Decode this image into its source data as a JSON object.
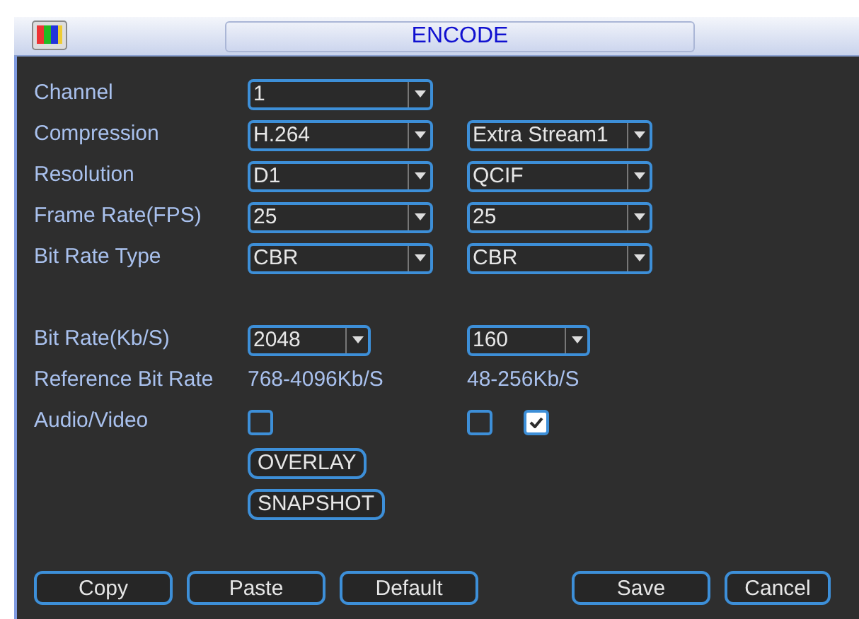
{
  "window": {
    "title": "ENCODE"
  },
  "rows": [
    {
      "kind": "dropdowns",
      "label": "Channel",
      "values": [
        "1"
      ]
    },
    {
      "kind": "dropdowns",
      "label": "Compression",
      "values": [
        "H.264",
        "Extra Stream1"
      ]
    },
    {
      "kind": "dropdowns",
      "label": "Resolution",
      "values": [
        "D1",
        "QCIF"
      ]
    },
    {
      "kind": "dropdowns",
      "label": "Frame Rate(FPS)",
      "values": [
        "25",
        "25"
      ]
    },
    {
      "kind": "dropdowns",
      "label": "Bit Rate Type",
      "values": [
        "CBR",
        "CBR"
      ]
    },
    {
      "kind": "spacer"
    },
    {
      "kind": "short_dropdowns",
      "label": "Bit Rate(Kb/S)",
      "values": [
        "2048",
        "160"
      ]
    },
    {
      "kind": "texts",
      "label": "Reference Bit Rate",
      "values": [
        "768-4096Kb/S",
        "48-256Kb/S"
      ]
    },
    {
      "kind": "checkboxes",
      "label": "Audio/Video",
      "checks": [
        [
          false
        ],
        [
          false,
          true
        ]
      ]
    }
  ],
  "side_buttons": [
    "OVERLAY",
    "SNAPSHOT"
  ],
  "buttons_left": [
    "Copy",
    "Paste",
    "Default"
  ],
  "buttons_right": [
    "Save",
    "Cancel"
  ]
}
